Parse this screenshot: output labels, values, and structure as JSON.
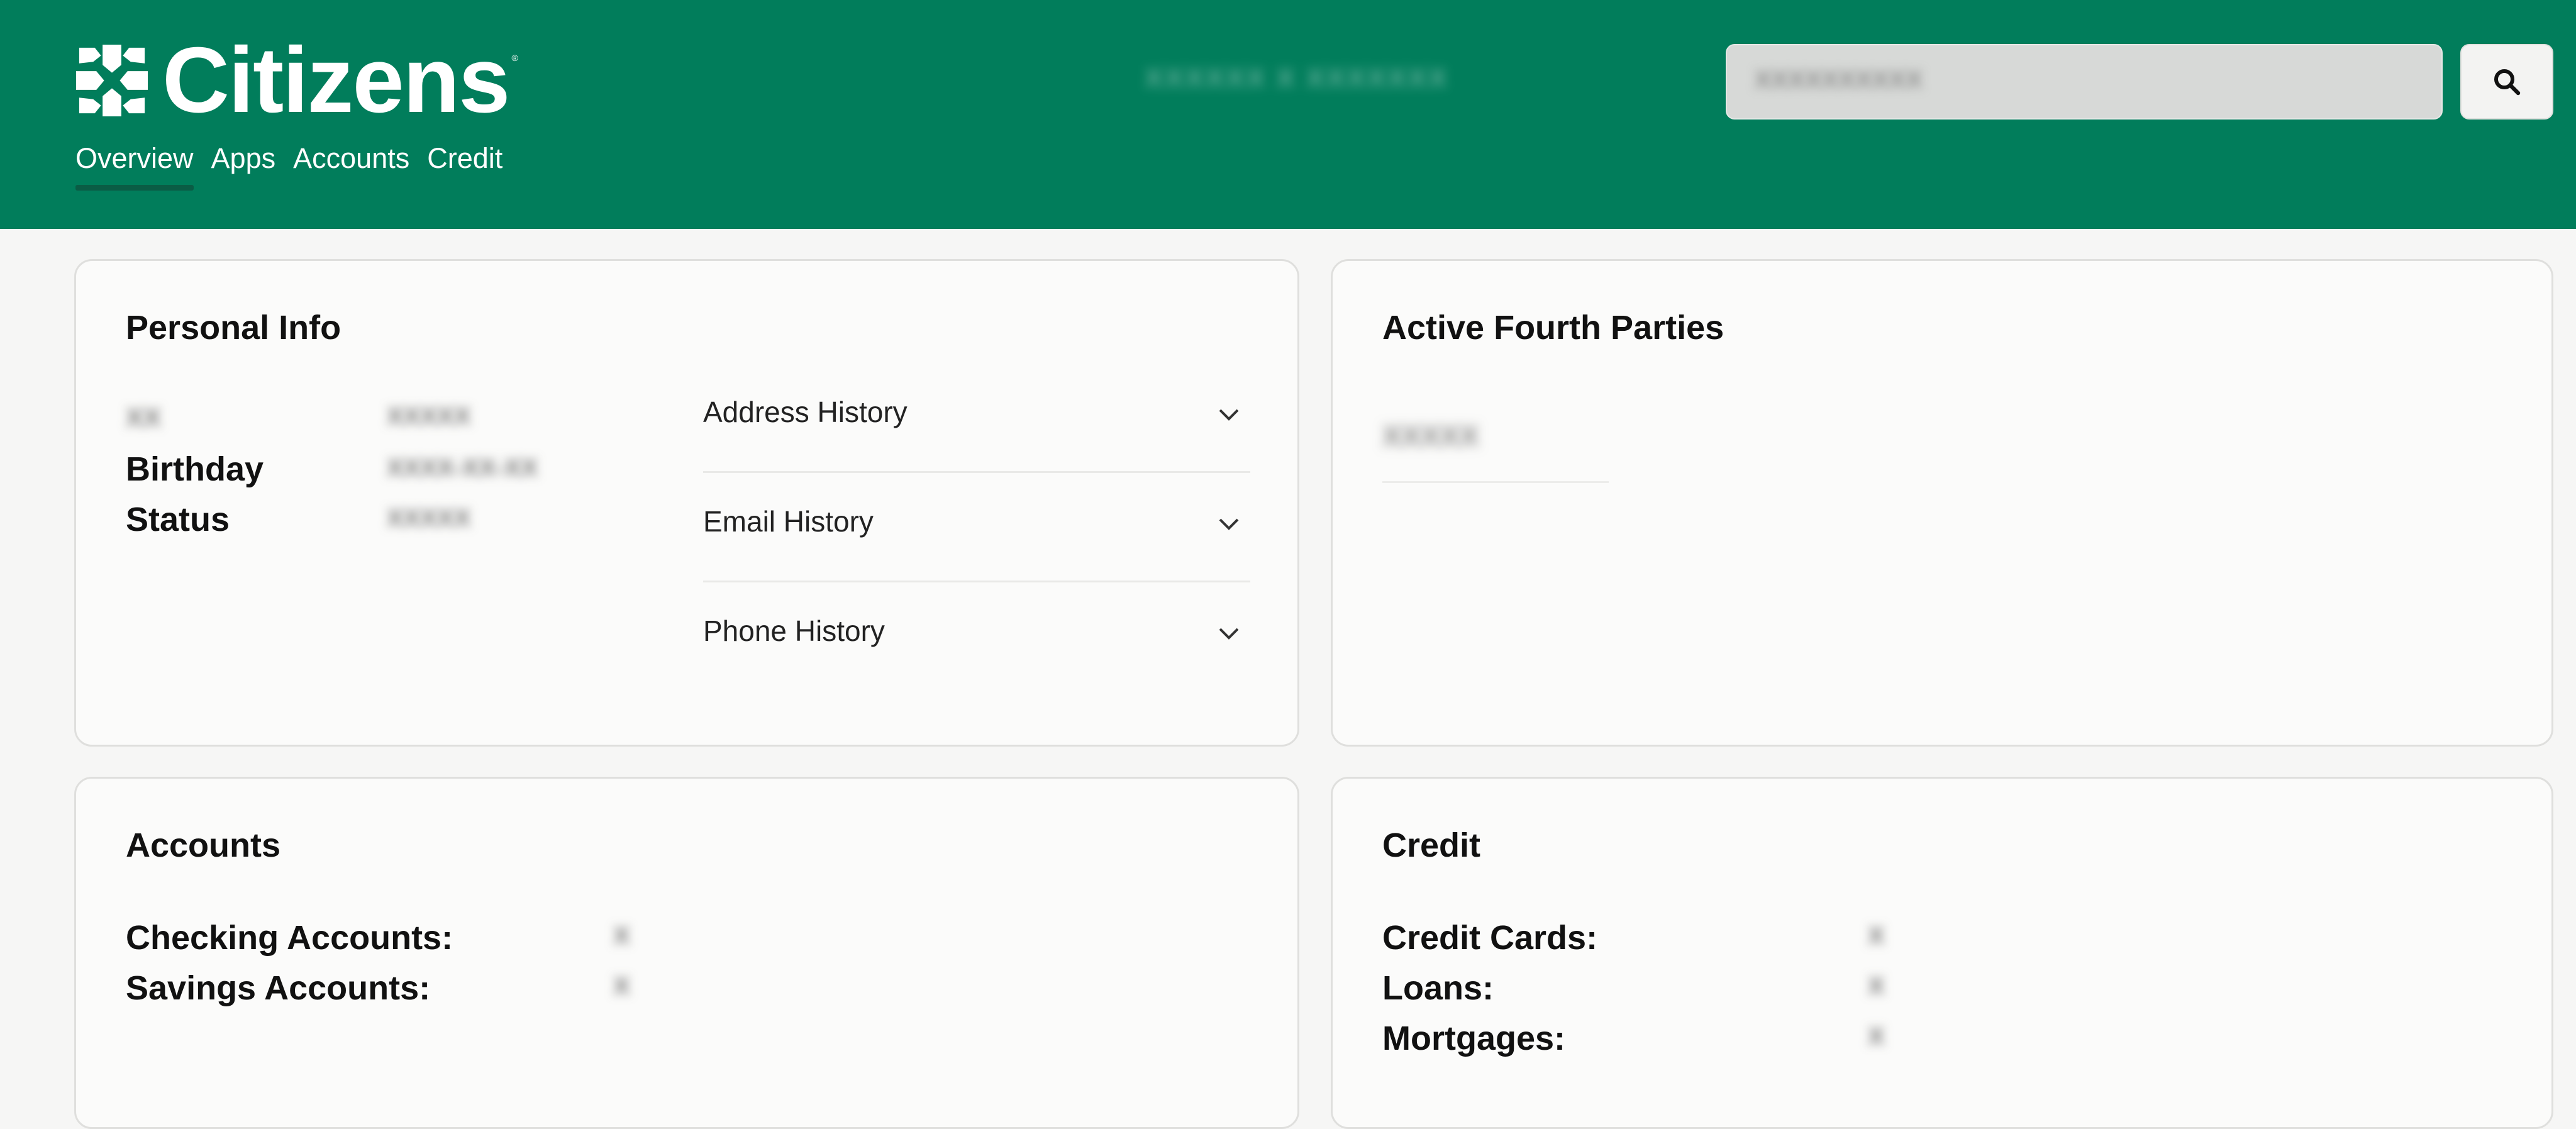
{
  "brand": {
    "name": "Citizens",
    "reg_mark": "®",
    "logo_icon": "citizens-cross-mark-icon",
    "color": "#017d5b"
  },
  "nav": {
    "items": [
      {
        "label": "Overview",
        "active": true
      },
      {
        "label": "Apps",
        "active": false
      },
      {
        "label": "Accounts",
        "active": false
      },
      {
        "label": "Credit",
        "active": false
      }
    ]
  },
  "header": {
    "user_name": "XXXXXX X XXXXXXX"
  },
  "search": {
    "value": "XXXXXXXXXX",
    "button_icon": "search-icon"
  },
  "personal_info": {
    "title": "Personal Info",
    "fields": [
      {
        "label": "XX",
        "value": "XXXXX",
        "label_blurred": true
      },
      {
        "label": "Birthday",
        "value": "XXXX-XX-XX"
      },
      {
        "label": "Status",
        "value": "XXXXX"
      }
    ],
    "history": [
      {
        "label": "Address History",
        "icon": "chevron-down-icon"
      },
      {
        "label": "Email History",
        "icon": "chevron-down-icon"
      },
      {
        "label": "Phone History",
        "icon": "chevron-down-icon"
      }
    ]
  },
  "fourth_parties": {
    "title": "Active Fourth Parties",
    "items": [
      "XXXXX"
    ]
  },
  "accounts": {
    "title": "Accounts",
    "fields": [
      {
        "label": "Checking Accounts:",
        "value": "X"
      },
      {
        "label": "Savings Accounts:",
        "value": "X"
      }
    ]
  },
  "credit": {
    "title": "Credit",
    "fields": [
      {
        "label": "Credit Cards:",
        "value": "X"
      },
      {
        "label": "Loans:",
        "value": "X"
      },
      {
        "label": "Mortgages:",
        "value": "X"
      }
    ]
  }
}
